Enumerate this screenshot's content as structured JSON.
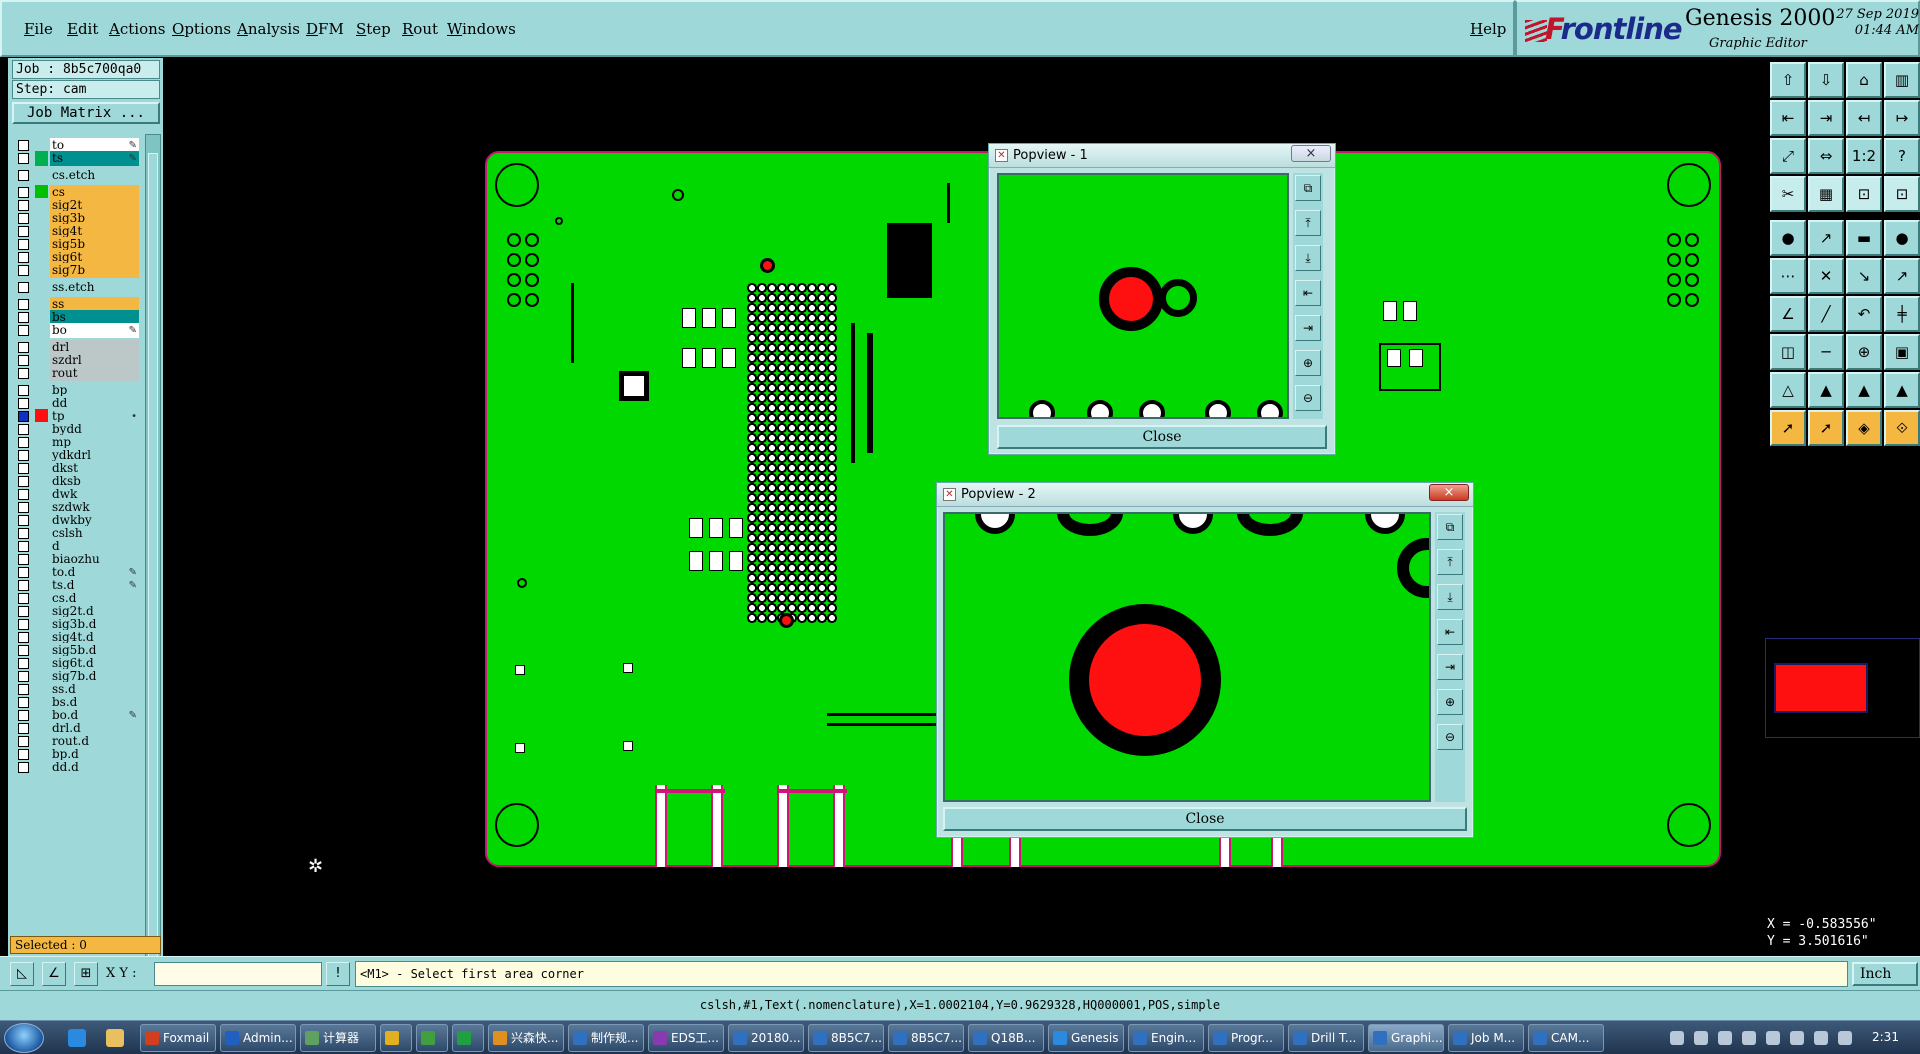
{
  "menubar": {
    "items": [
      "File",
      "Edit",
      "Actions",
      "Options",
      "Analysis",
      "DFM",
      "Step",
      "Rout",
      "Windows"
    ],
    "help": "Help"
  },
  "brand": {
    "logo_prefix": "F",
    "logo_rest": "rontline",
    "product": "Genesis 2000",
    "subtitle": "Graphic Editor",
    "date": "27 Sep 2019",
    "time": "01:44 AM"
  },
  "job": {
    "job_label": "Job : 8b5c700qa0",
    "step_label": "Step: cam",
    "matrix_button": "Job Matrix ..."
  },
  "layers": [
    {
      "name": "to",
      "color": "#ffffff",
      "marker": "pen"
    },
    {
      "name": "ts",
      "color": "#009090",
      "marker": "pen",
      "indicator": "#00b050"
    },
    {
      "name": "cs.etch",
      "color": "#9ed8d8",
      "gap": true
    },
    {
      "name": "cs",
      "color": "#f4b842",
      "gap": true,
      "indicator": "#00c000"
    },
    {
      "name": "sig2t",
      "color": "#f4b842"
    },
    {
      "name": "sig3b",
      "color": "#f4b842"
    },
    {
      "name": "sig4t",
      "color": "#f4b842"
    },
    {
      "name": "sig5b",
      "color": "#f4b842"
    },
    {
      "name": "sig6t",
      "color": "#f4b842"
    },
    {
      "name": "sig7b",
      "color": "#f4b842"
    },
    {
      "name": "ss.etch",
      "color": "#9ed8d8",
      "gap": true
    },
    {
      "name": "ss",
      "color": "#f4b842",
      "gap": true
    },
    {
      "name": "bs",
      "color": "#009090"
    },
    {
      "name": "bo",
      "color": "#ffffff",
      "marker": "pen"
    },
    {
      "name": "drl",
      "color": "#bcc8c8",
      "gap": true
    },
    {
      "name": "szdrl",
      "color": "#bcc8c8"
    },
    {
      "name": "rout",
      "color": "#bcc8c8"
    },
    {
      "name": "bp",
      "color": "#9ed8d8",
      "gap": true
    },
    {
      "name": "dd",
      "color": "#9ed8d8"
    },
    {
      "name": "tp",
      "color": "#9ed8d8",
      "indicator": "#ff1010",
      "chk": "#1030c0",
      "marker": "dot"
    },
    {
      "name": "bydd",
      "color": "#9ed8d8"
    },
    {
      "name": "mp",
      "color": "#9ed8d8"
    },
    {
      "name": "ydkdrl",
      "color": "#9ed8d8"
    },
    {
      "name": "dkst",
      "color": "#9ed8d8"
    },
    {
      "name": "dksb",
      "color": "#9ed8d8"
    },
    {
      "name": "dwk",
      "color": "#9ed8d8"
    },
    {
      "name": "szdwk",
      "color": "#9ed8d8"
    },
    {
      "name": "dwkby",
      "color": "#9ed8d8"
    },
    {
      "name": "cslsh",
      "color": "#9ed8d8"
    },
    {
      "name": "d",
      "color": "#9ed8d8"
    },
    {
      "name": "biaozhu",
      "color": "#9ed8d8"
    },
    {
      "name": "to.d",
      "color": "#9ed8d8",
      "marker": "pen"
    },
    {
      "name": "ts.d",
      "color": "#9ed8d8",
      "marker": "pen"
    },
    {
      "name": "cs.d",
      "color": "#9ed8d8"
    },
    {
      "name": "sig2t.d",
      "color": "#9ed8d8"
    },
    {
      "name": "sig3b.d",
      "color": "#9ed8d8"
    },
    {
      "name": "sig4t.d",
      "color": "#9ed8d8"
    },
    {
      "name": "sig5b.d",
      "color": "#9ed8d8"
    },
    {
      "name": "sig6t.d",
      "color": "#9ed8d8"
    },
    {
      "name": "sig7b.d",
      "color": "#9ed8d8"
    },
    {
      "name": "ss.d",
      "color": "#9ed8d8"
    },
    {
      "name": "bs.d",
      "color": "#9ed8d8"
    },
    {
      "name": "bo.d",
      "color": "#9ed8d8",
      "marker": "pen"
    },
    {
      "name": "drl.d",
      "color": "#9ed8d8"
    },
    {
      "name": "rout.d",
      "color": "#9ed8d8"
    },
    {
      "name": "bp.d",
      "color": "#9ed8d8"
    },
    {
      "name": "dd.d",
      "color": "#9ed8d8"
    }
  ],
  "selected": "Selected : 0",
  "popview1": {
    "title": "Popview - 1",
    "close": "Close",
    "close_x": "×"
  },
  "popview2": {
    "title": "Popview - 2",
    "close": "Close",
    "close_x": "×"
  },
  "coords": {
    "x": "X = -0.583556\"",
    "y": "Y = 3.501616\""
  },
  "cmdbar": {
    "xy_label": "X Y :",
    "xy_value": "",
    "prompt": "<M1> - Select first area corner",
    "units": "Inch"
  },
  "status_line": "cslsh,#1,Text(.nomenclature),X=1.0002104,Y=0.9629328,HQ000001,POS,simple",
  "taskbar": {
    "tasks": [
      "Foxmail",
      "Admin...",
      "计算器",
      "",
      "",
      "",
      "兴森快...",
      "制作规...",
      "EDS工...",
      "20180...",
      "8B5C7...",
      "8B5C7...",
      "Q18B...",
      "Genesis",
      "Engin...",
      "Progr...",
      "Drill T...",
      "Graphi...",
      "Job M...",
      "CAM..."
    ],
    "clock": "2:31"
  },
  "colors": {
    "panel": "#9ed8d8",
    "board": "#00d800",
    "accent_red": "#ff1010",
    "layer_active": "#f4b842"
  }
}
